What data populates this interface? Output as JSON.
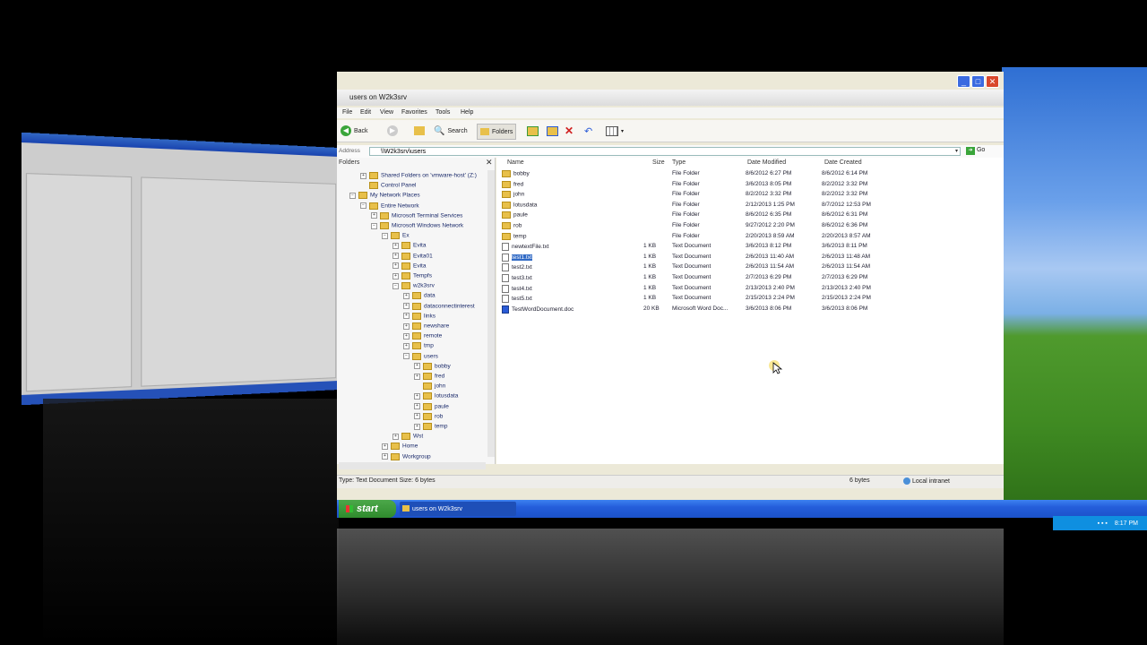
{
  "window": {
    "title": "users on W2k3srv",
    "controls": [
      "_",
      "□",
      "✕"
    ]
  },
  "menubar": [
    "File",
    "Edit",
    "View",
    "Favorites",
    "Tools",
    "Help"
  ],
  "toolbar": {
    "back": "Back",
    "search": "Search",
    "folders": "Folders"
  },
  "addressbar": {
    "label": "Address",
    "value": "\\\\W2k3srv\\users",
    "go": "Go"
  },
  "folders_pane": {
    "header": "Folders",
    "close": "✕",
    "items": [
      {
        "label": "Shared Folders on 'vmware-host' (Z:)",
        "level": 1,
        "exp": "+"
      },
      {
        "label": "Control Panel",
        "level": 1,
        "exp": ""
      },
      {
        "label": "My Network Places",
        "level": 0,
        "exp": "−"
      },
      {
        "label": "Entire Network",
        "level": 1,
        "exp": "−"
      },
      {
        "label": "Microsoft Terminal Services",
        "level": 2,
        "exp": "+"
      },
      {
        "label": "Microsoft Windows Network",
        "level": 2,
        "exp": "−"
      },
      {
        "label": "Ex",
        "level": 3,
        "exp": "−"
      },
      {
        "label": "Evita",
        "level": 4,
        "exp": "+"
      },
      {
        "label": "Evita01",
        "level": 4,
        "exp": "+"
      },
      {
        "label": "Evita",
        "level": 4,
        "exp": "+"
      },
      {
        "label": "Tempfs",
        "level": 4,
        "exp": "+"
      },
      {
        "label": "w2k3srv",
        "level": 4,
        "exp": "−"
      },
      {
        "label": "data",
        "level": 5,
        "exp": "+"
      },
      {
        "label": "dataconnectinterest",
        "level": 5,
        "exp": "+"
      },
      {
        "label": "links",
        "level": 5,
        "exp": "+"
      },
      {
        "label": "newshare",
        "level": 5,
        "exp": "+"
      },
      {
        "label": "remote",
        "level": 5,
        "exp": "+"
      },
      {
        "label": "tmp",
        "level": 5,
        "exp": "+"
      },
      {
        "label": "users",
        "level": 5,
        "exp": "−"
      },
      {
        "label": "bobby",
        "level": 6,
        "exp": "+"
      },
      {
        "label": "fred",
        "level": 6,
        "exp": "+"
      },
      {
        "label": "john",
        "level": 6,
        "exp": ""
      },
      {
        "label": "lotusdata",
        "level": 6,
        "exp": "+"
      },
      {
        "label": "paule",
        "level": 6,
        "exp": "+"
      },
      {
        "label": "rob",
        "level": 6,
        "exp": "+"
      },
      {
        "label": "temp",
        "level": 6,
        "exp": "+"
      },
      {
        "label": "Wst",
        "level": 4,
        "exp": "+"
      },
      {
        "label": "Home",
        "level": 3,
        "exp": "+"
      },
      {
        "label": "Workgroup",
        "level": 3,
        "exp": "+"
      }
    ]
  },
  "filelist": {
    "columns": [
      "Name",
      "Size",
      "Type",
      "Date Modified",
      "Date Created"
    ],
    "rows": [
      {
        "name": "bobby",
        "size": "",
        "type": "File Folder",
        "modified": "8/6/2012 6:27 PM",
        "created": "8/6/2012 6:14 PM",
        "kind": "folder"
      },
      {
        "name": "fred",
        "size": "",
        "type": "File Folder",
        "modified": "3/6/2013 8:05 PM",
        "created": "8/2/2012 3:32 PM",
        "kind": "folder"
      },
      {
        "name": "john",
        "size": "",
        "type": "File Folder",
        "modified": "8/2/2012 3:32 PM",
        "created": "8/2/2012 3:32 PM",
        "kind": "folder"
      },
      {
        "name": "lotusdata",
        "size": "",
        "type": "File Folder",
        "modified": "2/12/2013 1:25 PM",
        "created": "8/7/2012 12:53 PM",
        "kind": "folder"
      },
      {
        "name": "paule",
        "size": "",
        "type": "File Folder",
        "modified": "8/6/2012 6:35 PM",
        "created": "8/6/2012 6:31 PM",
        "kind": "folder"
      },
      {
        "name": "rob",
        "size": "",
        "type": "File Folder",
        "modified": "9/27/2012 2:20 PM",
        "created": "8/6/2012 6:36 PM",
        "kind": "folder"
      },
      {
        "name": "temp",
        "size": "",
        "type": "File Folder",
        "modified": "2/20/2013 8:59 AM",
        "created": "2/20/2013 8:57 AM",
        "kind": "folder"
      },
      {
        "name": "newtextFile.txt",
        "size": "1 KB",
        "type": "Text Document",
        "modified": "3/6/2013 8:12 PM",
        "created": "3/6/2013 8:11 PM",
        "kind": "txt"
      },
      {
        "name": "test1.txt",
        "size": "1 KB",
        "type": "Text Document",
        "modified": "2/6/2013 11:40 AM",
        "created": "2/6/2013 11:48 AM",
        "kind": "txt",
        "selected": true
      },
      {
        "name": "test2.txt",
        "size": "1 KB",
        "type": "Text Document",
        "modified": "2/6/2013 11:54 AM",
        "created": "2/6/2013 11:54 AM",
        "kind": "txt"
      },
      {
        "name": "test3.txt",
        "size": "1 KB",
        "type": "Text Document",
        "modified": "2/7/2013 6:29 PM",
        "created": "2/7/2013 6:29 PM",
        "kind": "txt"
      },
      {
        "name": "test4.txt",
        "size": "1 KB",
        "type": "Text Document",
        "modified": "2/13/2013 2:40 PM",
        "created": "2/13/2013 2:40 PM",
        "kind": "txt"
      },
      {
        "name": "test5.txt",
        "size": "1 KB",
        "type": "Text Document",
        "modified": "2/15/2013 2:24 PM",
        "created": "2/15/2013 2:24 PM",
        "kind": "txt"
      },
      {
        "name": "TestWordDocument.doc",
        "size": "20 KB",
        "type": "Microsoft Word Doc...",
        "modified": "3/6/2013 8:06 PM",
        "created": "3/6/2013 8:06 PM",
        "kind": "doc"
      }
    ]
  },
  "statusbar": {
    "left": "Type: Text Document Size: 6 bytes",
    "size": "6 bytes",
    "zone": "Local intranet"
  },
  "taskbar": {
    "start": "start",
    "task": "users on W2k3srv",
    "clock": "8:17 PM"
  },
  "colors": {
    "titlebar_active": "#2b62d9",
    "selection": "#316ac5",
    "start_green": "#3a9a38"
  }
}
